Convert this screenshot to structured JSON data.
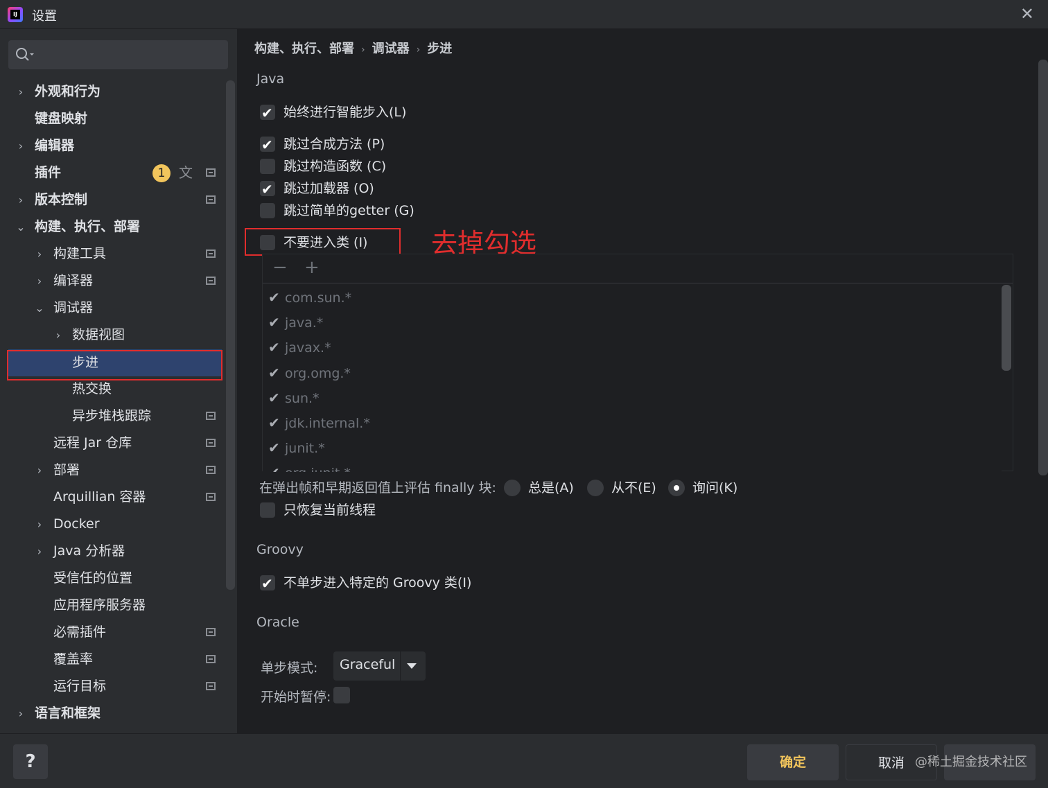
{
  "window": {
    "title": "设置",
    "close_glyph": "✕"
  },
  "search": {
    "icon": "search-icon"
  },
  "sidebar": {
    "items": [
      {
        "label": "外观和行为",
        "chevron": "›"
      },
      {
        "label": "键盘映射"
      },
      {
        "label": "编辑器",
        "chevron": "›"
      },
      {
        "label": "插件",
        "badge": "1"
      },
      {
        "label": "版本控制",
        "chevron": "›"
      },
      {
        "label": "构建、执行、部署",
        "chevron": "⌄"
      },
      {
        "label": "构建工具",
        "chevron": "›"
      },
      {
        "label": "编译器",
        "chevron": "›"
      },
      {
        "label": "调试器",
        "chevron": "⌄"
      },
      {
        "label": "数据视图",
        "chevron": "›"
      },
      {
        "label": "步进"
      },
      {
        "label": "热交换"
      },
      {
        "label": "异步堆栈跟踪"
      },
      {
        "label": "远程 Jar 仓库"
      },
      {
        "label": "部署",
        "chevron": "›"
      },
      {
        "label": "Arquillian 容器"
      },
      {
        "label": "Docker",
        "chevron": "›"
      },
      {
        "label": "Java 分析器",
        "chevron": "›"
      },
      {
        "label": "受信任的位置"
      },
      {
        "label": "应用程序服务器"
      },
      {
        "label": "必需插件"
      },
      {
        "label": "覆盖率"
      },
      {
        "label": "运行目标"
      },
      {
        "label": "语言和框架",
        "chevron": "›"
      }
    ]
  },
  "breadcrumb": {
    "part1": "构建、执行、部署",
    "part2": "调试器",
    "part3": "步进",
    "sep": "›"
  },
  "java": {
    "section": "Java",
    "always_smart_step_into": "始终进行智能步入(L)",
    "skip_synthetic": "跳过合成方法 (P)",
    "skip_constructors": "跳过构造函数 (C)",
    "skip_class_loaders": "跳过加载器 (O)",
    "skip_simple_getters": "跳过简单的getter (G)",
    "do_not_step_into": "不要进入类 (I)",
    "annotation": "去掉勾选",
    "toolbar": {
      "remove": "−",
      "add": "+"
    },
    "filters": [
      "com.sun.*",
      "java.*",
      "javax.*",
      "org.omg.*",
      "sun.*",
      "jdk.internal.*",
      "junit.*",
      "org.junit.*"
    ],
    "finally_label": "在弹出帧和早期返回值上评估 finally 块:",
    "finally_always": "总是(A)",
    "finally_never": "从不(E)",
    "finally_ask": "询问(K)",
    "resume_only_current": "只恢复当前线程"
  },
  "groovy": {
    "section": "Groovy",
    "do_not_step_into_groovy": "不单步进入特定的 Groovy 类(I)"
  },
  "oracle": {
    "section": "Oracle",
    "step_mode_label": "单步模式:",
    "step_mode_value": "Graceful",
    "pause_at_start_label": "开始时暂停:"
  },
  "footer": {
    "help": "?",
    "ok": "确定",
    "cancel": "取消",
    "watermark": "@稀土掘金技术社区"
  },
  "colors": {
    "accent_yellow": "#f2c55c",
    "annotation_red": "#e02d2d",
    "selection": "#2e436e"
  }
}
